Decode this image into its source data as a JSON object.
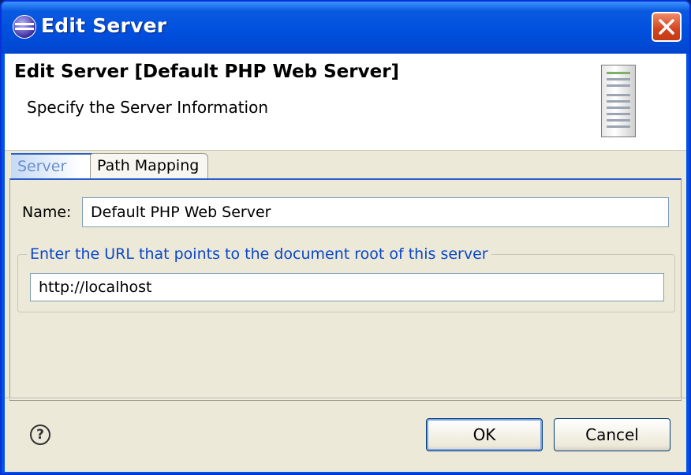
{
  "window": {
    "title": "Edit Server"
  },
  "banner": {
    "title": "Edit Server [Default PHP Web Server]",
    "subtitle": "Specify the Server Information",
    "icon": "server-icon"
  },
  "tabs": [
    {
      "label": "Server",
      "selected": true
    },
    {
      "label": "Path Mapping",
      "selected": false
    }
  ],
  "form": {
    "name_label": "Name:",
    "name_value": "Default PHP Web Server",
    "url_group_label": "Enter the URL that points to the document root of this server",
    "url_value": "http://localhost"
  },
  "buttons": {
    "ok": "OK",
    "cancel": "Cancel",
    "help": "?"
  },
  "colors": {
    "titlebar": "#0050de",
    "dialog_bg": "#ece9d8",
    "group_label": "#0b46c8"
  }
}
